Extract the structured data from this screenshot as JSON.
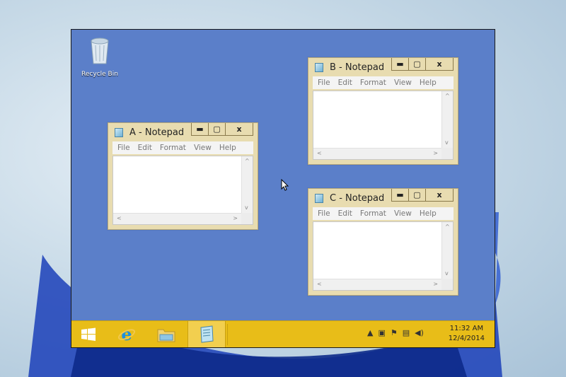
{
  "desktop": {
    "icons": [
      {
        "label": "Recycle Bin",
        "icon": "recycle-bin-icon"
      }
    ]
  },
  "windows": [
    {
      "id": "A",
      "title": "A - Notepad",
      "menu": [
        "File",
        "Edit",
        "Format",
        "View",
        "Help"
      ]
    },
    {
      "id": "B",
      "title": "B - Notepad",
      "menu": [
        "File",
        "Edit",
        "Format",
        "View",
        "Help"
      ]
    },
    {
      "id": "C",
      "title": "C - Notepad",
      "menu": [
        "File",
        "Edit",
        "Format",
        "View",
        "Help"
      ]
    }
  ],
  "window_controls": {
    "minimize": "▬",
    "maximize": "▢",
    "close": "x"
  },
  "taskbar": {
    "items": [
      {
        "name": "start-button",
        "icon": "windows-logo-icon"
      },
      {
        "name": "internet-explorer",
        "icon": "internet-explorer-icon"
      },
      {
        "name": "file-explorer",
        "icon": "folder-icon"
      },
      {
        "name": "notepad",
        "icon": "notepad-icon",
        "active": true
      }
    ],
    "tray": {
      "time": "11:32 AM",
      "date": "12/4/2014",
      "icons": [
        "show-hidden-icons-icon",
        "vm-icon",
        "action-center-flag-icon",
        "network-icon",
        "volume-icon"
      ]
    }
  },
  "colors": {
    "desktop_background": "#5b7fc9",
    "taskbar": "#e8bd18",
    "window_frame": "#e8dcb0"
  }
}
